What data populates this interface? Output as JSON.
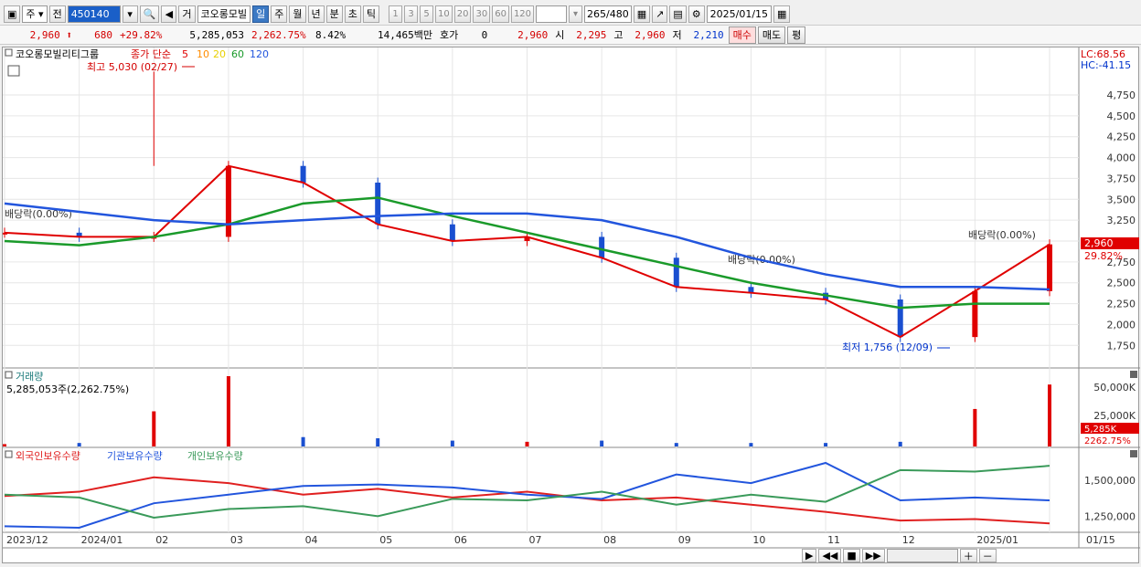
{
  "toolbar": {
    "kind_select": "주",
    "prev_label": "전",
    "code": "450140",
    "trade_label": "거",
    "name": "코오롱모빌",
    "periods": [
      "일",
      "주",
      "월",
      "년",
      "분",
      "초",
      "틱"
    ],
    "active_period": "일",
    "intervals": [
      "1",
      "3",
      "5",
      "10",
      "20",
      "30",
      "60",
      "120"
    ],
    "count_display": "265",
    "count_total": "/480",
    "date": "2025/01/15"
  },
  "quote": {
    "price": "2,960",
    "change": "680",
    "change_rate": "+29.82%",
    "volume": "5,285,053",
    "volume_rate": "2,262.75%",
    "turnover_rate": "8.42%",
    "amount": "14,465백만",
    "hoga_label": "호가",
    "hoga_value": "0",
    "hoga_price": "2,960",
    "open_label": "시",
    "open": "2,295",
    "high_label": "고",
    "high": "2,960",
    "low_label": "저",
    "low": "2,210",
    "buy_label": "매수",
    "sell_label": "매도",
    "avg_label": "평"
  },
  "price_panel": {
    "title": "코오롱모빌리티그룹",
    "ma_label": "종가 단순",
    "ma_periods": [
      "5",
      "10",
      "20",
      "60",
      "120"
    ],
    "lc": "LC:68.56",
    "hc": "HC:-41.15",
    "high_note": "최고 5,030 (02/27)",
    "low_note": "최저 1,756 (12/09)",
    "dividend_notes": [
      "배당락(0.00%)",
      "배당락(0.00%)",
      "배당락(0.00%)"
    ],
    "last_price": "2,960",
    "last_rate": "29.82%"
  },
  "volume_panel": {
    "title": "거래량",
    "value": "5,285,053주(2,262.75%)",
    "last_value": "5,285K",
    "last_rate": "2262.75%"
  },
  "holdings_panel": {
    "titles": [
      "외국인보유수량",
      "기관보유수량",
      "개인보유수량"
    ]
  },
  "xaxis": {
    "labels": [
      "2023/12",
      "2024/01",
      "02",
      "03",
      "04",
      "05",
      "06",
      "07",
      "08",
      "09",
      "10",
      "11",
      "12",
      "2025/01",
      "01/15"
    ]
  },
  "chart_data": [
    {
      "type": "candlestick",
      "title": "코오롱모빌리티그룹",
      "x": [
        "2023/12",
        "2024/01",
        "02",
        "03",
        "04",
        "05",
        "06",
        "07",
        "08",
        "09",
        "10",
        "11",
        "12",
        "2025/01",
        "01/15"
      ],
      "close": [
        3100,
        3050,
        3050,
        3900,
        3700,
        3200,
        3000,
        3050,
        2800,
        2450,
        2380,
        2300,
        1850,
        2400,
        2960
      ],
      "ylim": [
        1600,
        5100
      ],
      "yticks": [
        "1,750",
        "2,000",
        "2,250",
        "2,500",
        "2,750",
        "3,000",
        "3,250",
        "3,500",
        "3,750",
        "4,000",
        "4,250",
        "4,500",
        "4,750"
      ],
      "series": [
        {
          "name": "5",
          "color": "#e00000"
        },
        {
          "name": "10",
          "color": "#ff8c00"
        },
        {
          "name": "20",
          "color": "#f5e000"
        },
        {
          "name": "60",
          "color": "#1a9a2a"
        },
        {
          "name": "120",
          "color": "#2255dd"
        }
      ],
      "ma60": [
        3000,
        2950,
        3050,
        3200,
        3450,
        3520,
        3300,
        3100,
        2900,
        2700,
        2500,
        2350,
        2200,
        2250,
        2250
      ],
      "ma120": [
        3450,
        3350,
        3250,
        3200,
        3250,
        3300,
        3330,
        3330,
        3250,
        3050,
        2800,
        2600,
        2450,
        2450,
        2420
      ],
      "high_point": {
        "x": "02",
        "value": 5030
      },
      "low_point": {
        "x": "12",
        "value": 1756
      }
    },
    {
      "type": "bar",
      "title": "거래량",
      "x": [
        "2023/12",
        "2024/01",
        "02",
        "03",
        "04",
        "05",
        "06",
        "07",
        "08",
        "09",
        "10",
        "11",
        "12",
        "2025/01",
        "01/15"
      ],
      "values": [
        200,
        300,
        3000,
        6000,
        800,
        700,
        500,
        400,
        500,
        300,
        300,
        300,
        400,
        3200,
        5285
      ],
      "unit": "K",
      "yticks": [
        "25,000K",
        "50,000K"
      ]
    },
    {
      "type": "line",
      "title": "보유수량",
      "x": [
        "2023/12",
        "2024/01",
        "02",
        "03",
        "04",
        "05",
        "06",
        "07",
        "08",
        "09",
        "10",
        "11",
        "12",
        "2025/01",
        "01/15"
      ],
      "yticks": [
        "1,250,000",
        "1,500,000"
      ],
      "series": [
        {
          "name": "외국인보유수량",
          "color": "#e02020",
          "values": [
            1390000,
            1420000,
            1520000,
            1480000,
            1400000,
            1440000,
            1380000,
            1420000,
            1360000,
            1380000,
            1330000,
            1280000,
            1220000,
            1230000,
            1200000
          ]
        },
        {
          "name": "기관보유수량",
          "color": "#2255dd",
          "values": [
            1180000,
            1170000,
            1340000,
            1400000,
            1460000,
            1470000,
            1450000,
            1400000,
            1370000,
            1540000,
            1480000,
            1620000,
            1360000,
            1380000,
            1360000
          ]
        },
        {
          "name": "개인보유수량",
          "color": "#3a9a5a",
          "values": [
            1400000,
            1380000,
            1240000,
            1300000,
            1320000,
            1250000,
            1370000,
            1360000,
            1420000,
            1330000,
            1400000,
            1350000,
            1570000,
            1560000,
            1600000
          ]
        }
      ]
    }
  ]
}
